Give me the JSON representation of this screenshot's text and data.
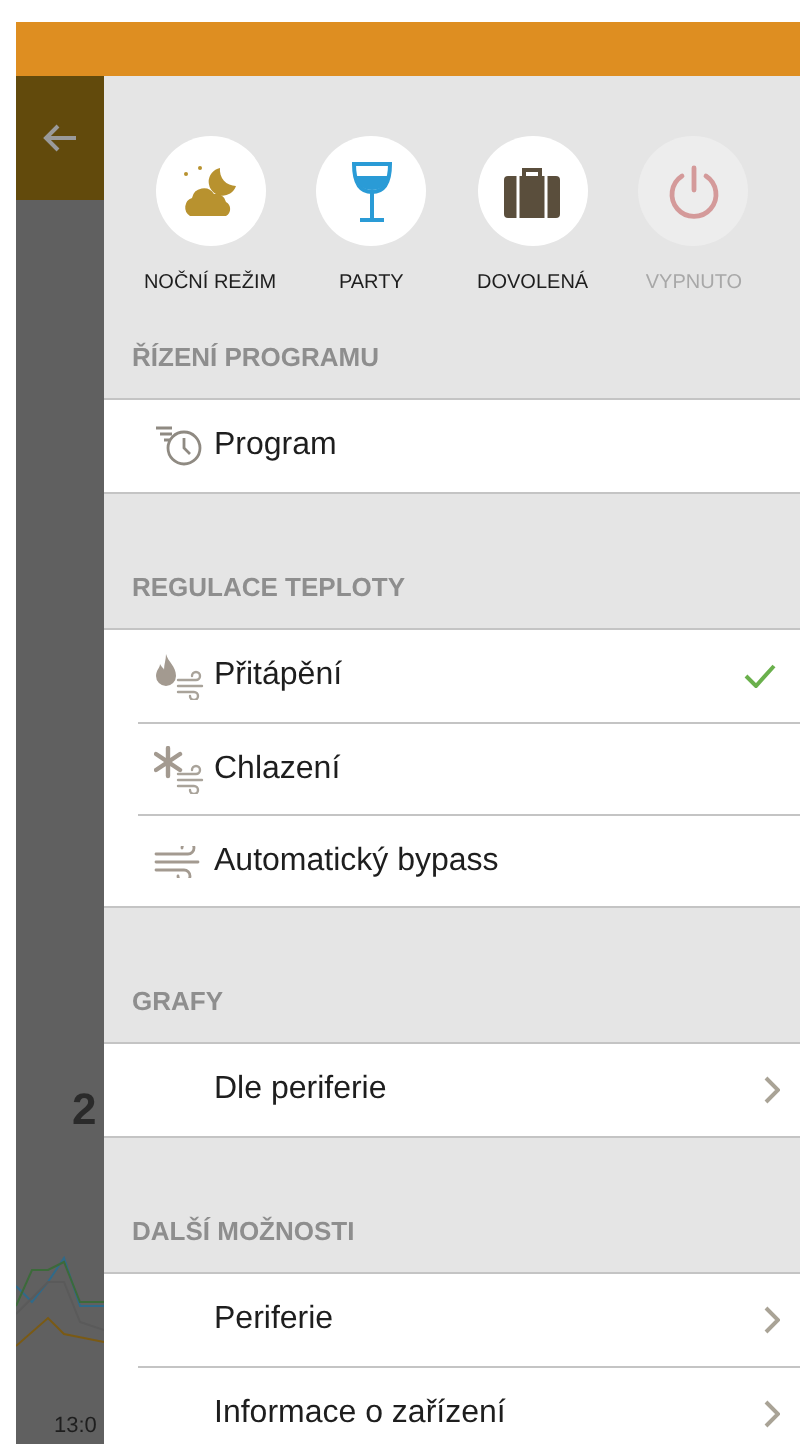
{
  "background": {
    "value": "2",
    "time": "13:0"
  },
  "modes": [
    {
      "label": "NOČNÍ REŽIM",
      "dimmed": false
    },
    {
      "label": "PARTY",
      "dimmed": false
    },
    {
      "label": "DOVOLENÁ",
      "dimmed": false
    },
    {
      "label": "VYPNUTO",
      "dimmed": true
    }
  ],
  "sections": [
    {
      "title": "ŘÍZENÍ PROGRAMU",
      "items": [
        {
          "label": "Program",
          "kind": "plain"
        }
      ]
    },
    {
      "title": "REGULACE TEPLOTY",
      "items": [
        {
          "label": "Přitápění",
          "kind": "option",
          "checked": true
        },
        {
          "label": "Chlazení",
          "kind": "option",
          "checked": false
        },
        {
          "label": "Automatický bypass",
          "kind": "option",
          "checked": false
        }
      ]
    },
    {
      "title": "GRAFY",
      "items": [
        {
          "label": "Dle periferie",
          "kind": "link"
        }
      ]
    },
    {
      "title": "DALŠÍ MOŽNOSTI",
      "items": [
        {
          "label": "Periferie",
          "kind": "link"
        },
        {
          "label": "Informace o zařízení",
          "kind": "link"
        }
      ]
    }
  ]
}
